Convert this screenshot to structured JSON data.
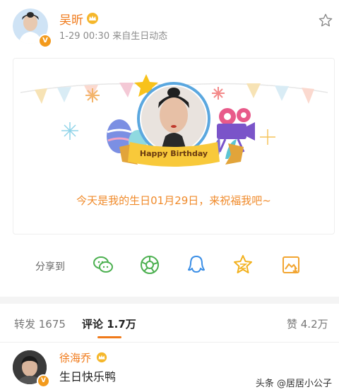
{
  "post": {
    "username": "吴昕",
    "meta": "1-29 00:30  来自生日动态"
  },
  "card": {
    "banner_label": "Happy Birthday",
    "message": "今天是我的生日01月29日，来祝福我吧~"
  },
  "share": {
    "label": "分享到",
    "icons": [
      "wechat-icon",
      "moments-icon",
      "qq-icon",
      "qzone-icon",
      "save-image-icon"
    ]
  },
  "tabs": {
    "repost": "转发 1675",
    "comment": "评论 1.7万",
    "like": "赞 4.2万"
  },
  "comment": {
    "username": "徐海乔",
    "text": "生日快乐鸭"
  },
  "watermark": "头条 @居居小公子",
  "colors": {
    "accent": "#f07a1a",
    "verify": "#f39a1c",
    "share_green": "#4cb050",
    "share_blue": "#3a8ee6",
    "share_yellow": "#f2b11e"
  }
}
